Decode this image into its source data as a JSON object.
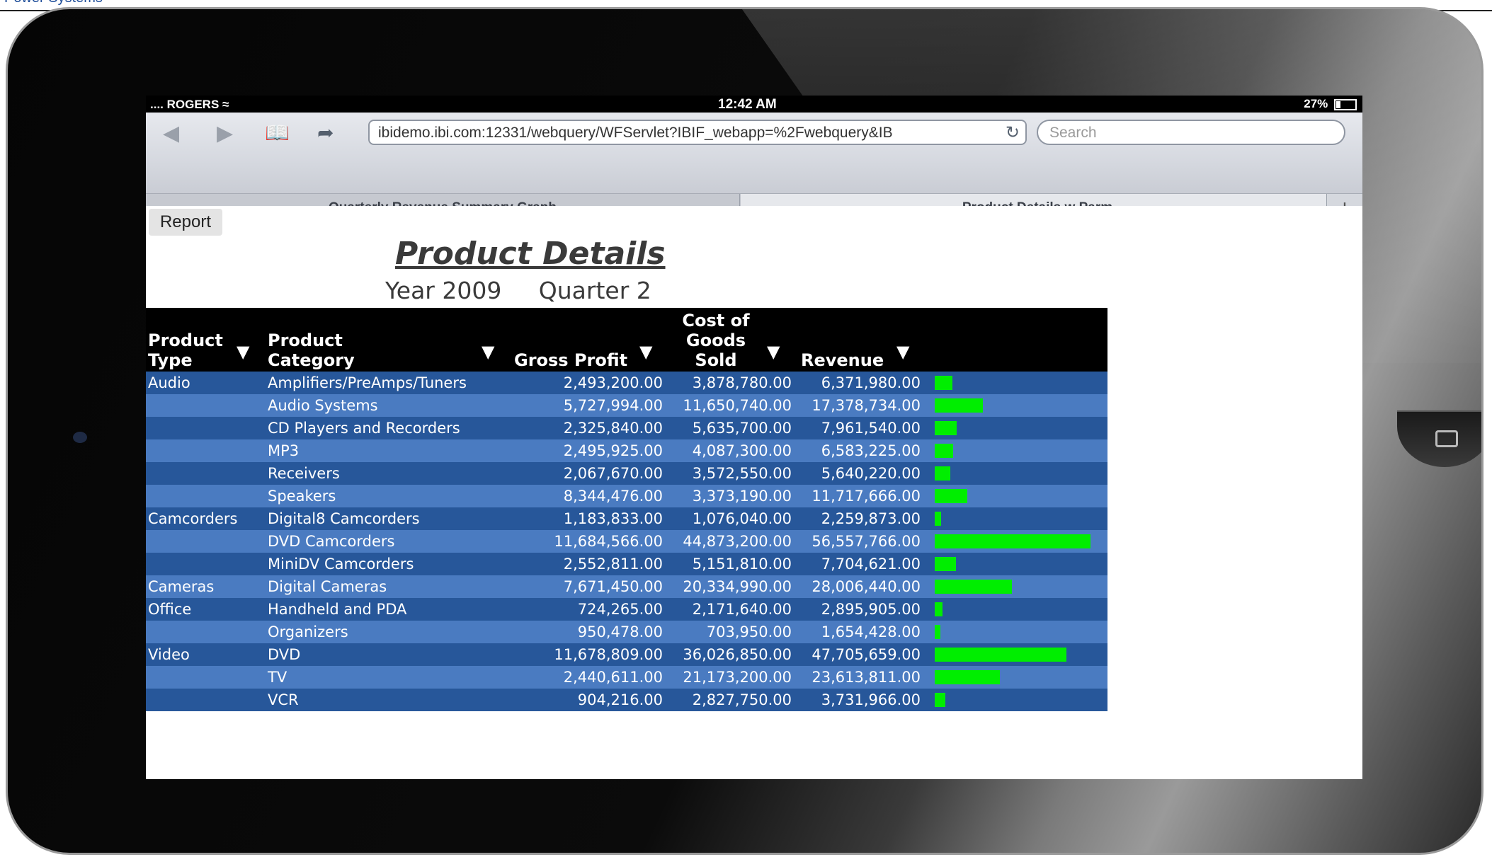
{
  "page": {
    "top_cut_text": "Power Systems"
  },
  "status_bar": {
    "carrier": ".... ROGERS",
    "time": "12:42 AM",
    "battery": "27%"
  },
  "browser": {
    "url": "ibidemo.ibi.com:12331/webquery/WFServlet?IBIF_webapp=%2Fwebquery&IB",
    "search_placeholder": "Search",
    "tabs": [
      {
        "label": "Quarterly Revenue Summary Graph",
        "close": "×"
      },
      {
        "label": "Product Details w Parm"
      }
    ],
    "add_tab": "+"
  },
  "report": {
    "button_label": "Report",
    "title": "Product Details",
    "subtitle": "Year 2009     Quarter 2",
    "columns": {
      "type": [
        "Product",
        "Type"
      ],
      "category": [
        "Product",
        "Category"
      ],
      "gross_profit": "Gross Profit",
      "cogs": [
        "Cost of",
        "Goods",
        "Sold"
      ],
      "revenue": "Revenue",
      "arrow": "▼"
    },
    "rows": [
      {
        "type": "Audio",
        "category": "Amplifiers/PreAmps/Tuners",
        "gross_profit": "2,493,200.00",
        "cogs": "3,878,780.00",
        "revenue": "6,371,980.00",
        "bar": 6371980
      },
      {
        "type": "",
        "category": "Audio Systems",
        "gross_profit": "5,727,994.00",
        "cogs": "11,650,740.00",
        "revenue": "17,378,734.00",
        "bar": 17378734
      },
      {
        "type": "",
        "category": "CD Players and Recorders",
        "gross_profit": "2,325,840.00",
        "cogs": "5,635,700.00",
        "revenue": "7,961,540.00",
        "bar": 7961540
      },
      {
        "type": "",
        "category": "MP3",
        "gross_profit": "2,495,925.00",
        "cogs": "4,087,300.00",
        "revenue": "6,583,225.00",
        "bar": 6583225
      },
      {
        "type": "",
        "category": "Receivers",
        "gross_profit": "2,067,670.00",
        "cogs": "3,572,550.00",
        "revenue": "5,640,220.00",
        "bar": 5640220
      },
      {
        "type": "",
        "category": "Speakers",
        "gross_profit": "8,344,476.00",
        "cogs": "3,373,190.00",
        "revenue": "11,717,666.00",
        "bar": 11717666
      },
      {
        "type": "Camcorders",
        "category": "Digital8 Camcorders",
        "gross_profit": "1,183,833.00",
        "cogs": "1,076,040.00",
        "revenue": "2,259,873.00",
        "bar": 2259873
      },
      {
        "type": "",
        "category": "DVD Camcorders",
        "gross_profit": "11,684,566.00",
        "cogs": "44,873,200.00",
        "revenue": "56,557,766.00",
        "bar": 56557766
      },
      {
        "type": "",
        "category": "MiniDV Camcorders",
        "gross_profit": "2,552,811.00",
        "cogs": "5,151,810.00",
        "revenue": "7,704,621.00",
        "bar": 7704621
      },
      {
        "type": "Cameras",
        "category": "Digital Cameras",
        "gross_profit": "7,671,450.00",
        "cogs": "20,334,990.00",
        "revenue": "28,006,440.00",
        "bar": 28006440
      },
      {
        "type": "Office",
        "category": "Handheld and PDA",
        "gross_profit": "724,265.00",
        "cogs": "2,171,640.00",
        "revenue": "2,895,905.00",
        "bar": 2895905
      },
      {
        "type": "",
        "category": "Organizers",
        "gross_profit": "950,478.00",
        "cogs": "703,950.00",
        "revenue": "1,654,428.00",
        "bar": 1654428
      },
      {
        "type": "Video",
        "category": "DVD",
        "gross_profit": "11,678,809.00",
        "cogs": "36,026,850.00",
        "revenue": "47,705,659.00",
        "bar": 47705659
      },
      {
        "type": "",
        "category": "TV",
        "gross_profit": "2,440,611.00",
        "cogs": "21,173,200.00",
        "revenue": "23,613,811.00",
        "bar": 23613811
      },
      {
        "type": "",
        "category": "VCR",
        "gross_profit": "904,216.00",
        "cogs": "2,827,750.00",
        "revenue": "3,731,966.00",
        "bar": 3731966
      }
    ],
    "bar_color": "#00ee00",
    "row_colors": [
      "#27579a",
      "#4a7bc1"
    ]
  }
}
